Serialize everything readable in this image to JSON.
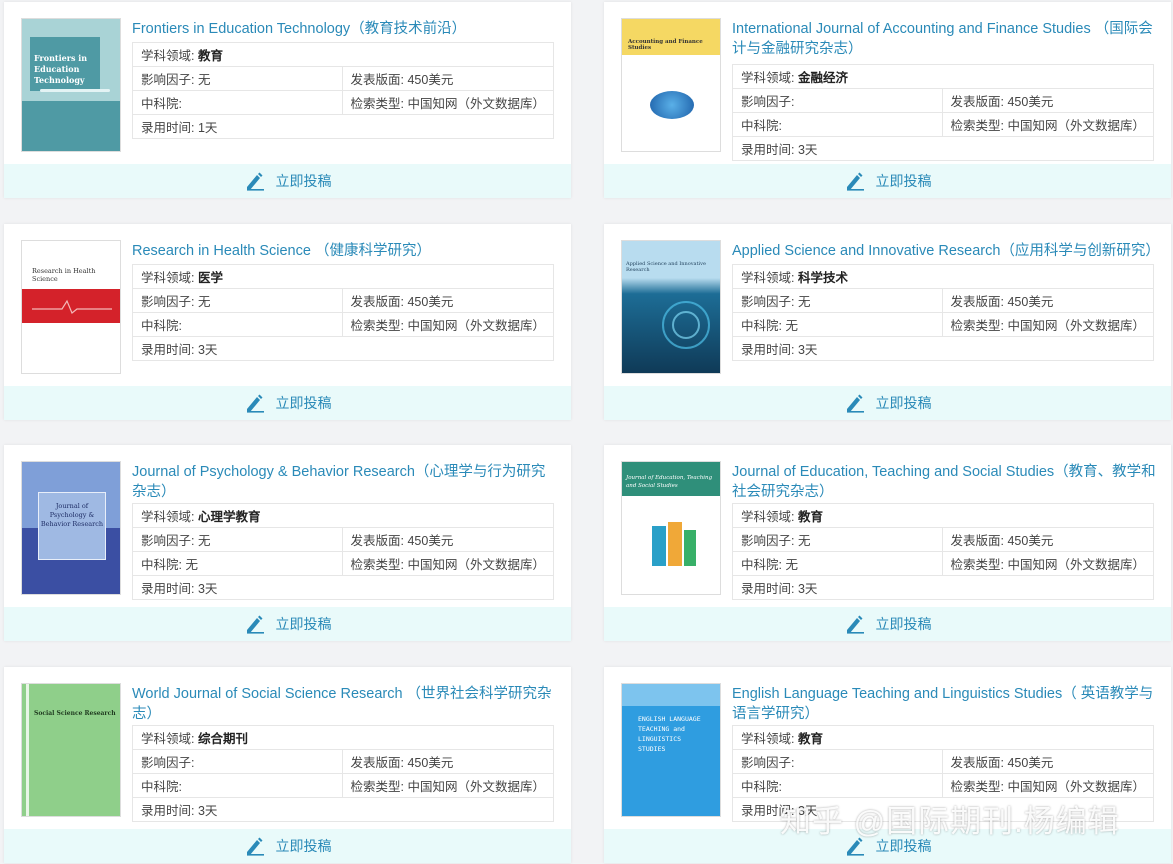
{
  "labels": {
    "field": "学科领域: ",
    "impact": "影响因子: ",
    "fee": "发表版面: ",
    "cas": "中科院: ",
    "index": "检索类型: ",
    "time": "录用时间: "
  },
  "submit_label": "立即投稿",
  "watermark": "知乎 @国际期刊.杨编辑",
  "journals": [
    {
      "title": "Frontiers in Education Technology（教育技术前沿）",
      "cover_title": "Frontiers in Education Technology",
      "field": "教育",
      "impact": "无",
      "fee": "450美元",
      "cas": "",
      "index": "中国知网（外文数据库）",
      "time": "1天"
    },
    {
      "title": "International Journal of Accounting and Finance Studies （国际会计与金融研究杂志）",
      "cover_title": "Accounting and Finance Studies",
      "field": "金融经济",
      "impact": "",
      "fee": "450美元",
      "cas": "",
      "index": "中国知网（外文数据库）",
      "time": "3天"
    },
    {
      "title": "Research in Health Science （健康科学研究）",
      "cover_title": "Research in Health Science",
      "field": "医学",
      "impact": "无",
      "fee": "450美元",
      "cas": "",
      "index": "中国知网（外文数据库）",
      "time": "3天"
    },
    {
      "title": "Applied Science and Innovative Research（应用科学与创新研究）",
      "cover_title": "Applied Science and Innovative Research",
      "field": "科学技术",
      "impact": "无",
      "fee": "450美元",
      "cas": "无",
      "index": "中国知网（外文数据库）",
      "time": "3天"
    },
    {
      "title": "Journal of Psychology & Behavior Research（心理学与行为研究杂志）",
      "cover_title": "Journal of Psychology & Behavior Research",
      "field": "心理学教育",
      "impact": "无",
      "fee": "450美元",
      "cas": "无",
      "index": "中国知网（外文数据库）",
      "time": "3天"
    },
    {
      "title": "Journal of Education, Teaching and Social Studies（教育、教学和社会研究杂志）",
      "cover_title": "Journal of Education, Teaching and Social Studies",
      "field": "教育",
      "impact": "无",
      "fee": "450美元",
      "cas": "无",
      "index": "中国知网（外文数据库）",
      "time": "3天"
    },
    {
      "title": "World Journal of Social Science Research （世界社会科学研究杂志）",
      "cover_title": "Social Science Research",
      "field": "综合期刊",
      "impact": "",
      "fee": "450美元",
      "cas": "",
      "index": "中国知网（外文数据库）",
      "time": "3天"
    },
    {
      "title": "English Language Teaching and Linguistics Studies（ 英语教学与语言学研究）",
      "cover_title": "ENGLISH LANGUAGE TEACHING and LINGUISTICS STUDIES",
      "field": "教育",
      "impact": "",
      "fee": "450美元",
      "cas": "",
      "index": "中国知网（外文数据库）",
      "time": "3天"
    }
  ]
}
